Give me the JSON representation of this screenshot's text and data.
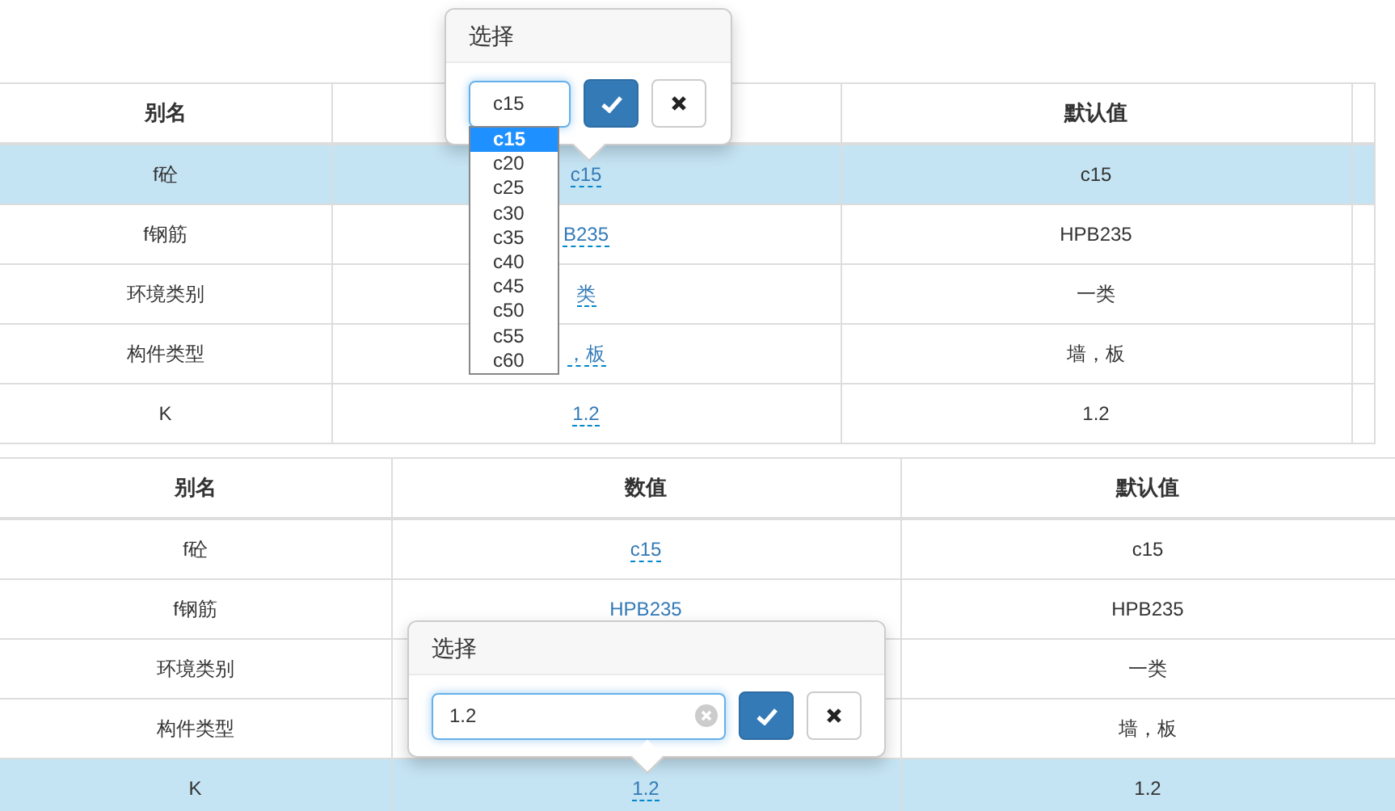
{
  "tables": [
    {
      "columns": [
        "别名",
        null,
        "默认值",
        null
      ],
      "rows": [
        {
          "alias": "f砼",
          "value": "c15",
          "default": "c15",
          "selected": true
        },
        {
          "alias": "f钢筋",
          "value": "B235",
          "default": "HPB235",
          "selected": false
        },
        {
          "alias": "环境类别",
          "value": "类",
          "default": "一类",
          "selected": false
        },
        {
          "alias": "构件类型",
          "value": "，板",
          "default": "墙，板",
          "selected": false
        },
        {
          "alias": "K",
          "value": "1.2",
          "default": "1.2",
          "selected": false
        }
      ]
    },
    {
      "columns": [
        "别名",
        "数值",
        "默认值"
      ],
      "rows": [
        {
          "alias": "f砼",
          "value": "c15",
          "default": "c15",
          "selected": false
        },
        {
          "alias": "f钢筋",
          "value": "HPB235",
          "default": "HPB235",
          "selected": false
        },
        {
          "alias": "环境类别",
          "value": null,
          "default": "一类",
          "selected": false
        },
        {
          "alias": "构件类型",
          "value": null,
          "default": "墙，板",
          "selected": false
        },
        {
          "alias": "K",
          "value": "1.2",
          "default": "1.2",
          "selected": true
        }
      ]
    }
  ],
  "popovers": [
    {
      "kind": "select",
      "title": "选择",
      "value": "c15",
      "options": [
        {
          "label": "c15",
          "selected": true
        },
        {
          "label": "c20",
          "selected": false
        },
        {
          "label": "c25",
          "selected": false
        },
        {
          "label": "c30",
          "selected": false
        },
        {
          "label": "c35",
          "selected": false
        },
        {
          "label": "c40",
          "selected": false
        },
        {
          "label": "c45",
          "selected": false
        },
        {
          "label": "c50",
          "selected": false
        },
        {
          "label": "c55",
          "selected": false
        },
        {
          "label": "c60",
          "selected": false
        }
      ]
    },
    {
      "kind": "text",
      "title": "选择",
      "value": "1.2"
    }
  ]
}
